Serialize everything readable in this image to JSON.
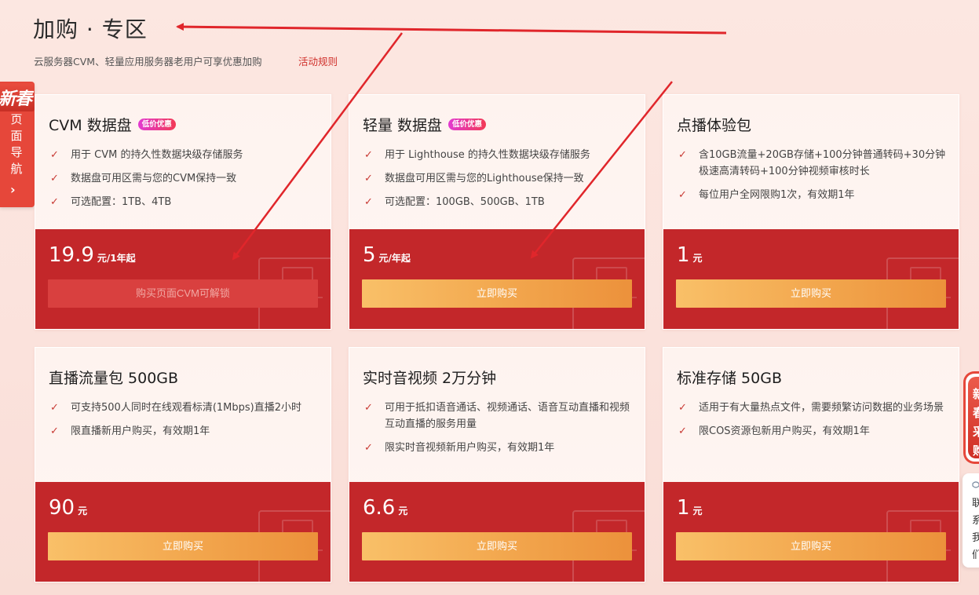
{
  "section": {
    "title": "加购 · 专区",
    "subtitle": "云服务器CVM、轻量应用服务器老用户可享优惠加购",
    "rules_link": "活动规则"
  },
  "left_nav": {
    "badge": "新春",
    "label_chars": [
      "页",
      "面",
      "导",
      "航"
    ],
    "chevron": "›"
  },
  "right_badge": {
    "chars": [
      "新",
      "春",
      "采",
      "购"
    ]
  },
  "right_contact": {
    "chars": [
      "联",
      "系",
      "我",
      "们"
    ]
  },
  "colors": {
    "accent_red": "#c3272a",
    "button_gold": "#f2a64d",
    "link_red": "#d0302b",
    "annotation_arrow": "#e0262b"
  },
  "cards": [
    {
      "title": "CVM 数据盘",
      "tag": "低价优惠",
      "features": [
        "用于 CVM 的持久性数据块级存储服务",
        "数据盘可用区需与您的CVM保持一致",
        "可选配置：1TB、4TB"
      ],
      "price": "19.9",
      "unit": "元/1年起",
      "button": "购买页面CVM可解锁",
      "button_locked": true
    },
    {
      "title": "轻量 数据盘",
      "tag": "低价优惠",
      "features": [
        "用于 Lighthouse 的持久性数据块级存储服务",
        "数据盘可用区需与您的Lighthouse保持一致",
        "可选配置：100GB、500GB、1TB"
      ],
      "price": "5",
      "unit": "元/年起",
      "button": "立即购买",
      "button_locked": false
    },
    {
      "title": "点播体验包",
      "tag": "",
      "features": [
        "含10GB流量+20GB存储+100分钟普通转码+30分钟极速高清转码+100分钟视频审核时长",
        "每位用户全网限购1次，有效期1年"
      ],
      "price": "1",
      "unit": "元",
      "button": "立即购买",
      "button_locked": false
    },
    {
      "title": "直播流量包 500GB",
      "tag": "",
      "features": [
        "可支持500人同时在线观看标清(1Mbps)直播2小时",
        "限直播新用户购买，有效期1年"
      ],
      "price": "90",
      "unit": "元",
      "button": "立即购买",
      "button_locked": false
    },
    {
      "title": "实时音视频 2万分钟",
      "tag": "",
      "features": [
        "可用于抵扣语音通话、视频通话、语音互动直播和视频互动直播的服务用量",
        "限实时音视频新用户购买，有效期1年"
      ],
      "price": "6.6",
      "unit": "元",
      "button": "立即购买",
      "button_locked": false
    },
    {
      "title": "标准存储 50GB",
      "tag": "",
      "features": [
        "适用于有大量热点文件，需要频繁访问数据的业务场景",
        "限COS资源包新用户购买，有效期1年"
      ],
      "price": "1",
      "unit": "元",
      "button": "立即购买",
      "button_locked": false
    }
  ]
}
